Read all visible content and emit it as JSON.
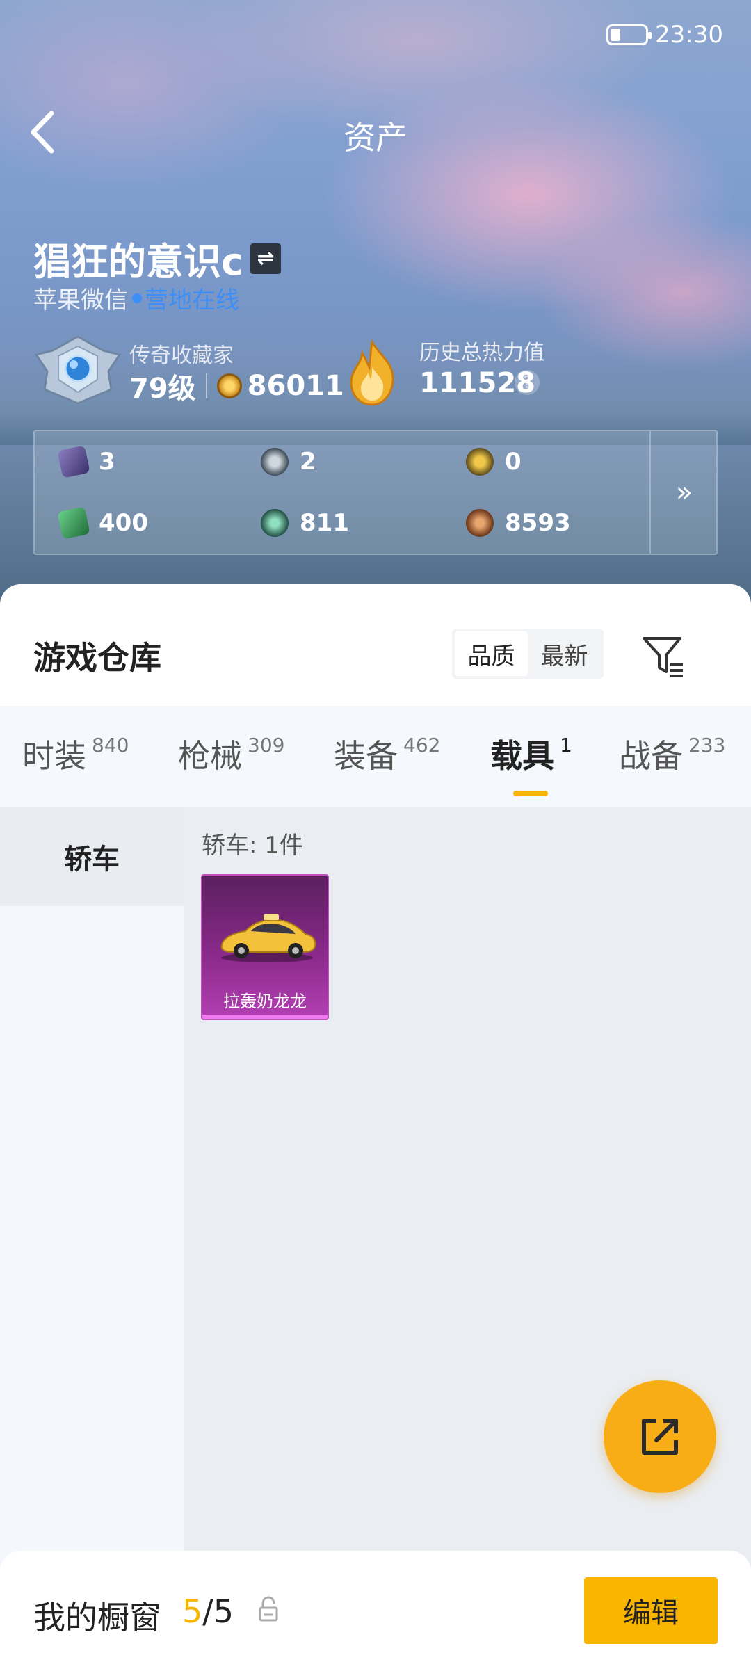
{
  "status_bar": {
    "time": "23:30"
  },
  "header": {
    "title": "资产"
  },
  "profile": {
    "username": "猖狂的意识c",
    "platform": "苹果微信",
    "online_status": "营地在线",
    "level_title": "传奇收藏家",
    "level": "79级",
    "collection_points": "86011",
    "heat_title": "历史总热力值",
    "heat_value": "111528",
    "help_icon": "?"
  },
  "stats": {
    "items": [
      {
        "icon": "card-icon",
        "value": "3",
        "color": "#5b4f8a"
      },
      {
        "icon": "coin-s-icon",
        "value": "2",
        "color": "#3d4a55"
      },
      {
        "icon": "coin-a-icon",
        "value": "0",
        "color": "#6d5a1f"
      },
      {
        "icon": "ticket-icon",
        "value": "400",
        "color": "#2f8a4a"
      },
      {
        "icon": "orb-icon",
        "value": "811",
        "color": "#2f6f5c"
      },
      {
        "icon": "medal-icon",
        "value": "8593",
        "color": "#8a4a22"
      }
    ],
    "more_label": "»"
  },
  "warehouse": {
    "title": "游戏仓库",
    "sort_options": [
      "品质",
      "最新"
    ],
    "sort_selected": "品质"
  },
  "tabs": [
    {
      "label": "时装",
      "count": "840"
    },
    {
      "label": "枪械",
      "count": "309"
    },
    {
      "label": "装备",
      "count": "462"
    },
    {
      "label": "载具",
      "count": "1",
      "active": true
    },
    {
      "label": "战备",
      "count": "233"
    }
  ],
  "sidebar": {
    "items": [
      {
        "label": "轿车",
        "selected": true
      }
    ]
  },
  "category": {
    "label": "轿车: 1件"
  },
  "items": [
    {
      "name": "拉轰奶龙龙",
      "rarity_color": "#b33fb3"
    }
  ],
  "showcase": {
    "label": "我的橱窗",
    "current": "5",
    "total": "/5"
  },
  "edit_button": {
    "label": "编辑"
  },
  "colors": {
    "accent": "#f7b500",
    "fab": "#f8ad17",
    "online": "#3d8ff5"
  }
}
